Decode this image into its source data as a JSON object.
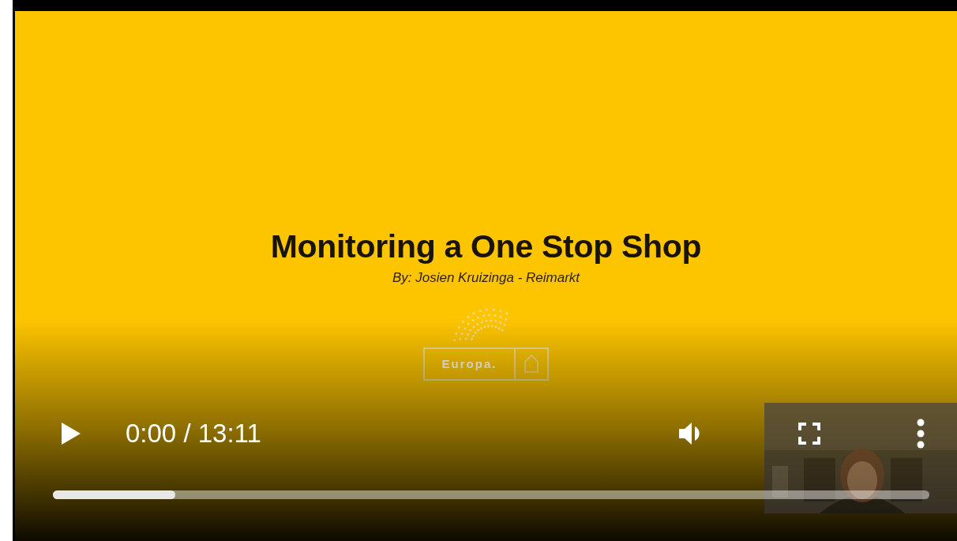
{
  "slide": {
    "title": "Monitoring a One Stop Shop",
    "subtitle": "By: Josien Kruizinga - Reimarkt",
    "logo_text": "Europa."
  },
  "controls": {
    "playing": false,
    "time": "0:00 / 13:11",
    "muted": false
  },
  "progress": {
    "level": 0.14
  }
}
